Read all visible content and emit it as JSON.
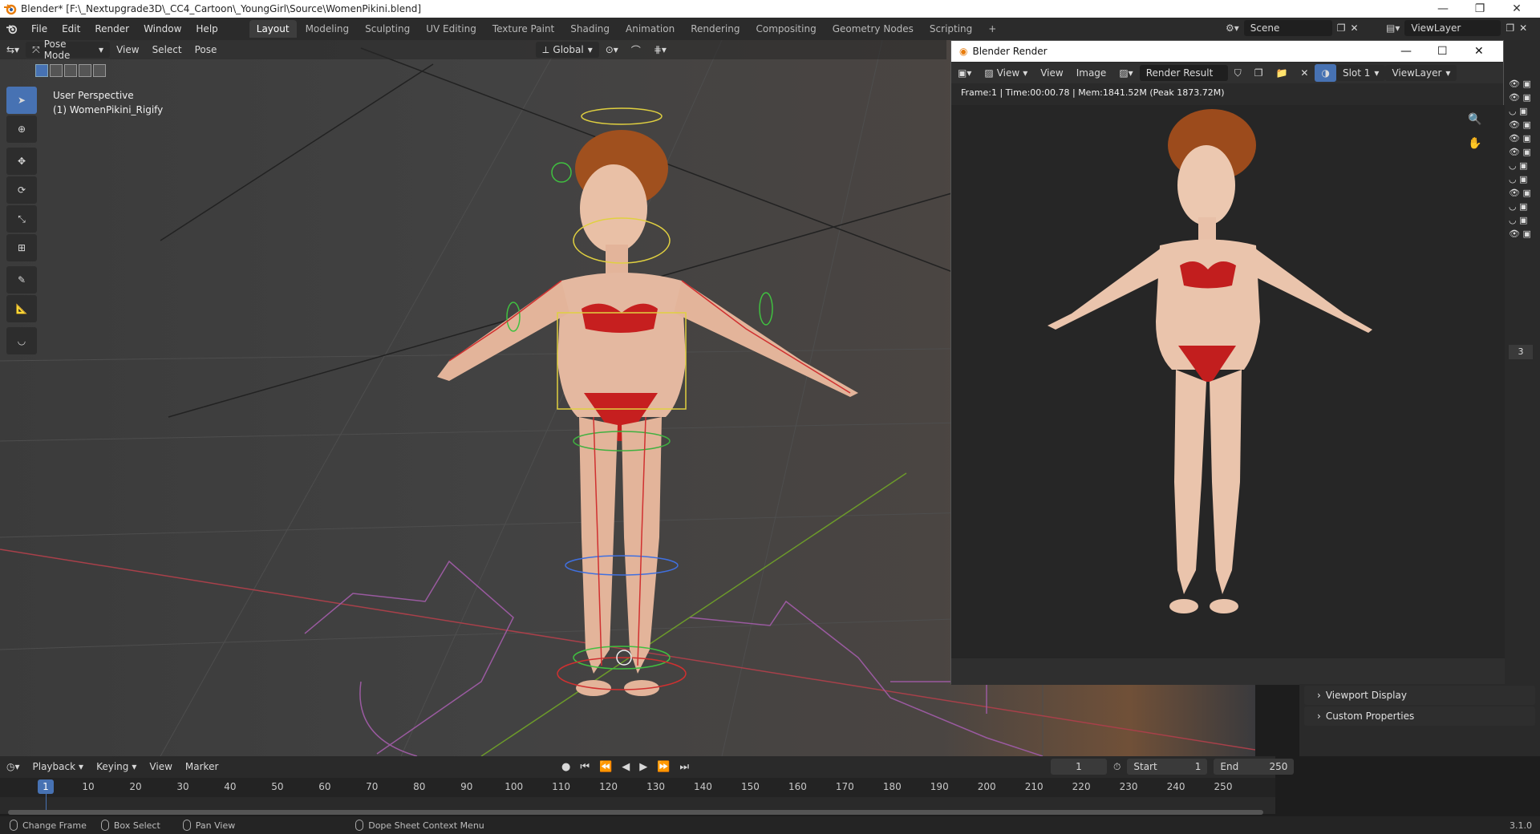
{
  "window": {
    "title": "Blender* [F:\\_Nextupgrade3D\\_CC4_Cartoon\\_YoungGirl\\Source\\WomenPikini.blend]"
  },
  "menu": [
    "File",
    "Edit",
    "Render",
    "Window",
    "Help"
  ],
  "workspaces": [
    {
      "label": "Layout",
      "active": true
    },
    {
      "label": "Modeling"
    },
    {
      "label": "Sculpting"
    },
    {
      "label": "UV Editing"
    },
    {
      "label": "Texture Paint"
    },
    {
      "label": "Shading"
    },
    {
      "label": "Animation"
    },
    {
      "label": "Rendering"
    },
    {
      "label": "Compositing"
    },
    {
      "label": "Geometry Nodes"
    },
    {
      "label": "Scripting"
    }
  ],
  "scene": {
    "label": "Scene",
    "viewlayer": "ViewLayer"
  },
  "viewport": {
    "mode": "Pose Mode",
    "menus": [
      "View",
      "Select",
      "Pose"
    ],
    "orientation": "Global",
    "perspective": "User Perspective",
    "object": "(1) WomenPikini_Rigify"
  },
  "render_window": {
    "title": "Blender Render",
    "menus": [
      "View",
      "View",
      "Image"
    ],
    "result": "Render Result",
    "slot": "Slot 1",
    "viewlayer": "ViewLayer",
    "stats": "Frame:1 | Time:00:00.78 | Mem:1841.52M (Peak 1873.72M)"
  },
  "properties": {
    "panels": [
      "Viewport Display",
      "Custom Properties"
    ],
    "number_field": "3"
  },
  "timeline": {
    "menus": [
      "Playback",
      "Keying",
      "View",
      "Marker"
    ],
    "current_frame": "1",
    "start_label": "Start",
    "start": "1",
    "end_label": "End",
    "end": "250",
    "ticks": [
      "1",
      "10",
      "20",
      "30",
      "40",
      "50",
      "60",
      "70",
      "80",
      "90",
      "100",
      "110",
      "120",
      "130",
      "140",
      "150",
      "160",
      "170",
      "180",
      "190",
      "200",
      "210",
      "220",
      "230",
      "240",
      "250"
    ]
  },
  "statusbar": {
    "items": [
      "Change Frame",
      "Box Select",
      "Pan View",
      "Dope Sheet Context Menu"
    ],
    "version": "3.1.0"
  },
  "colors": {
    "accent": "#4772b3",
    "header_bg": "#2b2b2b",
    "panel_bg": "#2a2a2a"
  }
}
